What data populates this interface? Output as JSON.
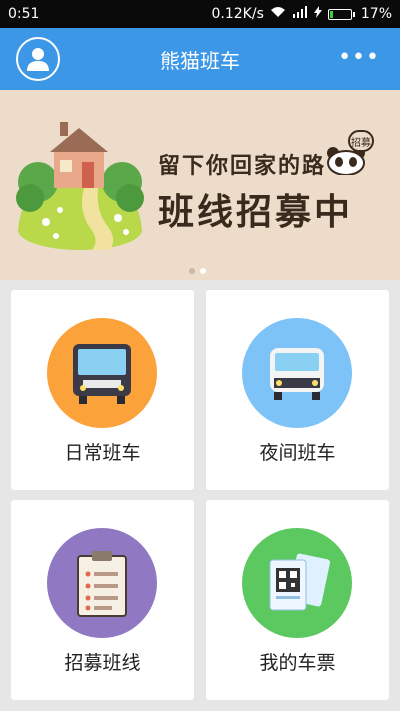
{
  "status_bar": {
    "time": "0:51",
    "network_speed": "0.12K/s",
    "battery": "17%"
  },
  "header": {
    "title": "熊猫班车",
    "more_icon": "more-icon"
  },
  "banner": {
    "line1": "留下你回家的路",
    "line2": "班线招募中",
    "badge": "招募",
    "page_count": 2,
    "active_page": 2
  },
  "menu": [
    {
      "label": "日常班车",
      "icon": "bus-icon",
      "color": "#fba23a"
    },
    {
      "label": "夜间班车",
      "icon": "van-icon",
      "color": "#7ec3f7"
    },
    {
      "label": "招募班线",
      "icon": "clipboard-icon",
      "color": "#9078c2"
    },
    {
      "label": "我的车票",
      "icon": "ticket-icon",
      "color": "#5cc860"
    }
  ]
}
